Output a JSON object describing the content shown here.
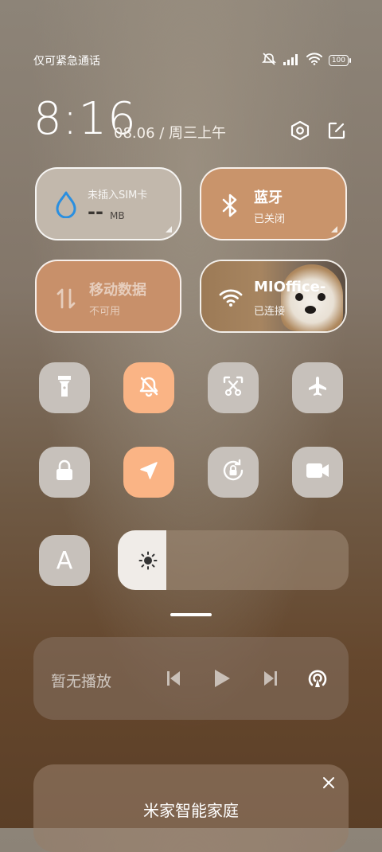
{
  "status_bar": {
    "carrier_text": "仅可紧急通话",
    "battery": "100"
  },
  "header": {
    "time": "8:16",
    "date": "08.06 / 周三上午"
  },
  "tiles": {
    "sim": {
      "label": "未插入SIM卡",
      "value": "--",
      "unit": "MB"
    },
    "bluetooth": {
      "label": "蓝牙",
      "status": "已关闭"
    },
    "mobile_data": {
      "label": "移动数据",
      "status": "不可用"
    },
    "wifi": {
      "label": "MIOffice-",
      "status": "已连接"
    }
  },
  "toggles": [
    {
      "name": "flashlight",
      "on": false
    },
    {
      "name": "mute",
      "on": true
    },
    {
      "name": "screenshot",
      "on": false
    },
    {
      "name": "airplane-mode",
      "on": false
    },
    {
      "name": "lock-screen",
      "on": false
    },
    {
      "name": "location",
      "on": true
    },
    {
      "name": "rotation-lock",
      "on": false
    },
    {
      "name": "screen-record",
      "on": false
    }
  ],
  "brightness": {
    "auto_label": "A",
    "level": 0.21
  },
  "media": {
    "title": "暂无播放"
  },
  "home_card": {
    "title": "米家智能家庭",
    "close": "×"
  },
  "colors": {
    "accent_on": "#fab485",
    "tile_off": "#c7c1bb"
  }
}
